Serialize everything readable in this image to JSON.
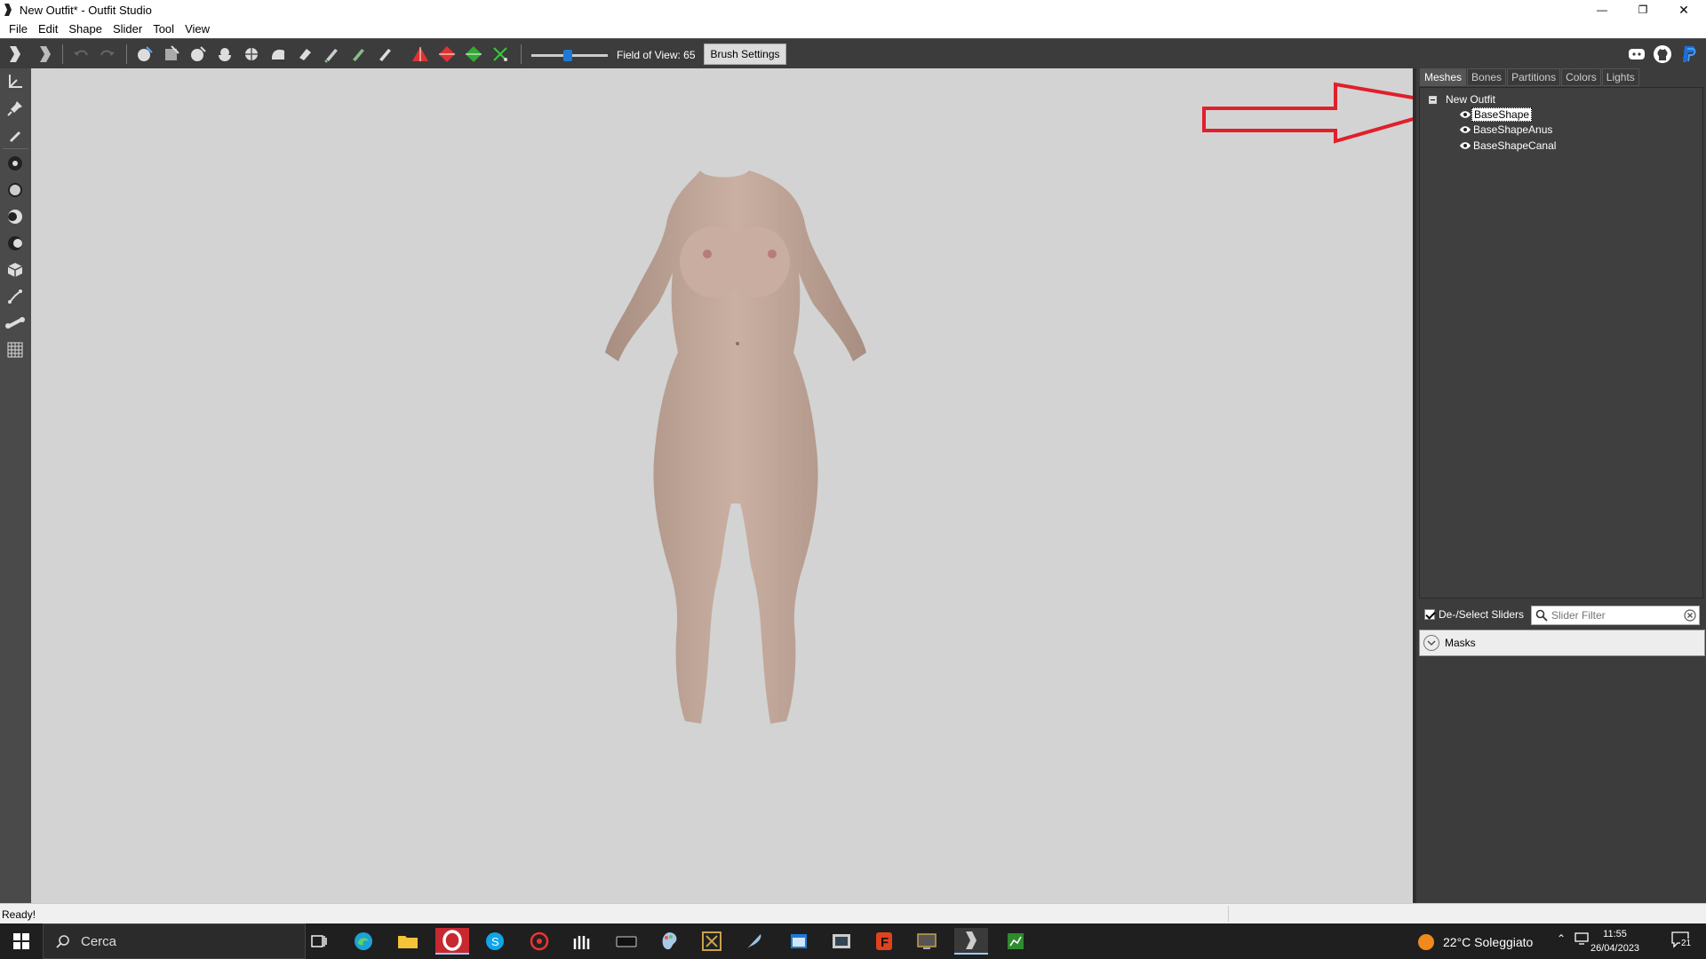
{
  "window": {
    "title": "New Outfit* - Outfit Studio",
    "minimize": "—",
    "restore": "❐",
    "close": "✕"
  },
  "menu": [
    "File",
    "Edit",
    "Shape",
    "Slider",
    "Tool",
    "View"
  ],
  "toolbar": {
    "fov_label": "Field of View: 65",
    "fov_value": 65,
    "brush_settings": "Brush Settings"
  },
  "right_panel": {
    "tabs": [
      "Meshes",
      "Bones",
      "Partitions",
      "Colors",
      "Lights"
    ],
    "active_tab": "Meshes",
    "tree": {
      "root": "New Outfit",
      "items": [
        {
          "label": "BaseShape",
          "selected": true
        },
        {
          "label": "BaseShapeAnus",
          "selected": false
        },
        {
          "label": "BaseShapeCanal",
          "selected": false
        }
      ]
    },
    "deselect_label": "De-/Select Sliders",
    "deselect_checked": true,
    "slider_filter_placeholder": "Slider Filter",
    "masks_label": "Masks"
  },
  "status": {
    "text": "Ready!"
  },
  "taskbar": {
    "search_placeholder": "Cerca",
    "weather": "22°C  Soleggiato",
    "time": "11:55",
    "date": "26/04/2023",
    "notifications": "21"
  },
  "annotation": {
    "arrow_color": "#e0202a"
  }
}
